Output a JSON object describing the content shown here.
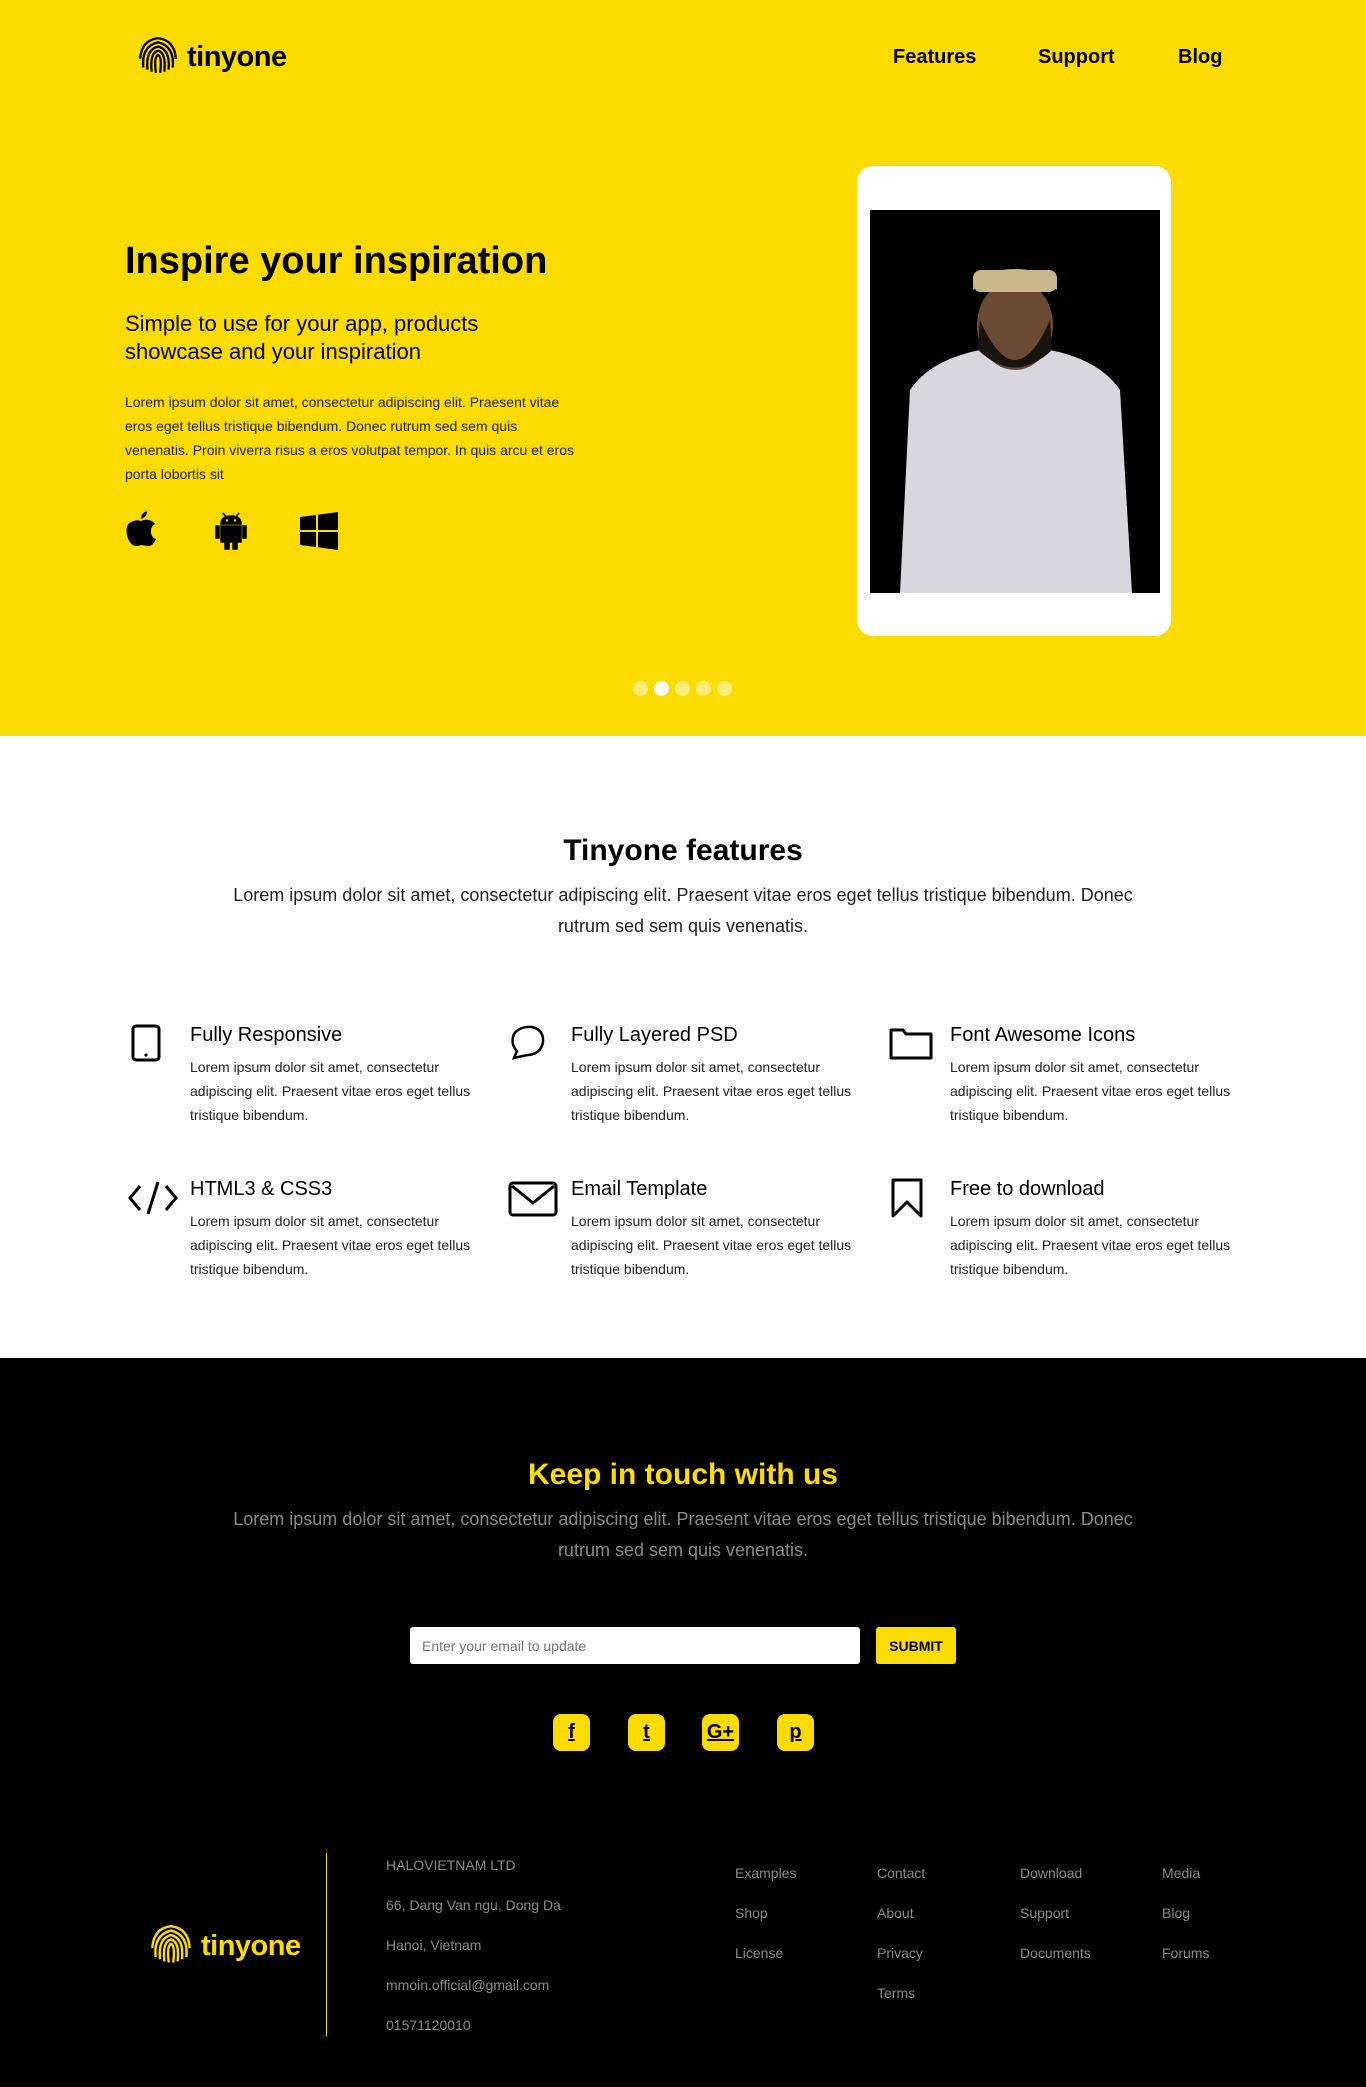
{
  "brand": {
    "name": "tinyone",
    "accent": "#fcdc00"
  },
  "nav": {
    "items": [
      "Features",
      "Support",
      "Blog"
    ]
  },
  "hero": {
    "title": "Inspire your inspiration",
    "subtitle": "Simple to use for your app, products showcase and your inspiration",
    "text": "Lorem ipsum dolor sit amet, consectetur adipiscing elit. Praesent vitae eros eget tellus tristique bibendum. Donec rutrum sed sem quis venenatis. Proin viverra risus a eros volutpat tempor. In quis arcu et eros porta lobortis sit",
    "platform_icons": [
      "apple-icon",
      "android-icon",
      "windows-icon"
    ],
    "slider": {
      "count": 5,
      "active": 2
    }
  },
  "features": {
    "title": "Tinyone features",
    "description": "Lorem ipsum dolor sit amet, consectetur adipiscing elit. Praesent vitae eros eget tellus tristique bibendum. Donec rutrum sed sem quis venenatis.",
    "items": [
      {
        "icon": "tablet-icon",
        "title": "Fully Responsive",
        "text": "Lorem ipsum dolor sit amet, consectetur adipiscing elit. Praesent vitae eros eget tellus tristique bibendum."
      },
      {
        "icon": "speech-bubble-icon",
        "title": "Fully Layered PSD",
        "text": "Lorem ipsum dolor sit amet, consectetur adipiscing elit. Praesent vitae eros eget tellus tristique bibendum."
      },
      {
        "icon": "folder-icon",
        "title": "Font Awesome Icons",
        "text": "Lorem ipsum dolor sit amet, consectetur adipiscing elit. Praesent vitae eros eget tellus tristique bibendum."
      },
      {
        "icon": "code-icon",
        "title": "HTML3 & CSS3",
        "text": "Lorem ipsum dolor sit amet, consectetur adipiscing elit. Praesent vitae eros eget tellus tristique bibendum."
      },
      {
        "icon": "envelope-icon",
        "title": "Email Template",
        "text": "Lorem ipsum dolor sit amet, consectetur adipiscing elit. Praesent vitae eros eget tellus tristique bibendum."
      },
      {
        "icon": "bookmark-icon",
        "title": "Free to download",
        "text": "Lorem ipsum dolor sit amet, consectetur adipiscing elit. Praesent vitae eros eget tellus tristique bibendum."
      }
    ]
  },
  "contact": {
    "title": "Keep in touch with us",
    "description": "Lorem ipsum dolor sit amet, consectetur adipiscing elit. Praesent vitae eros eget tellus tristique bibendum. Donec rutrum sed sem quis venenatis.",
    "email_placeholder": "Enter your email to update",
    "submit_label": "SUBMIT",
    "social": [
      {
        "icon": "facebook-icon",
        "glyph": "f"
      },
      {
        "icon": "twitter-icon",
        "glyph": "t"
      },
      {
        "icon": "google-plus-icon",
        "glyph": "G+"
      },
      {
        "icon": "pinterest-icon",
        "glyph": "p"
      }
    ]
  },
  "footer": {
    "address": [
      "HALOVIETNAM LTD",
      "66, Dang Van ngu, Dong Da",
      "Hanoi, Vietnam",
      "mmoin.official@gmail.com",
      "01571120010"
    ],
    "links": [
      [
        "Examples",
        "Shop",
        "License"
      ],
      [
        "Contact",
        "About",
        "Privacy",
        "Terms"
      ],
      [
        "Download",
        "Support",
        "Documents"
      ],
      [
        "Media",
        "Blog",
        "Forums"
      ]
    ]
  }
}
